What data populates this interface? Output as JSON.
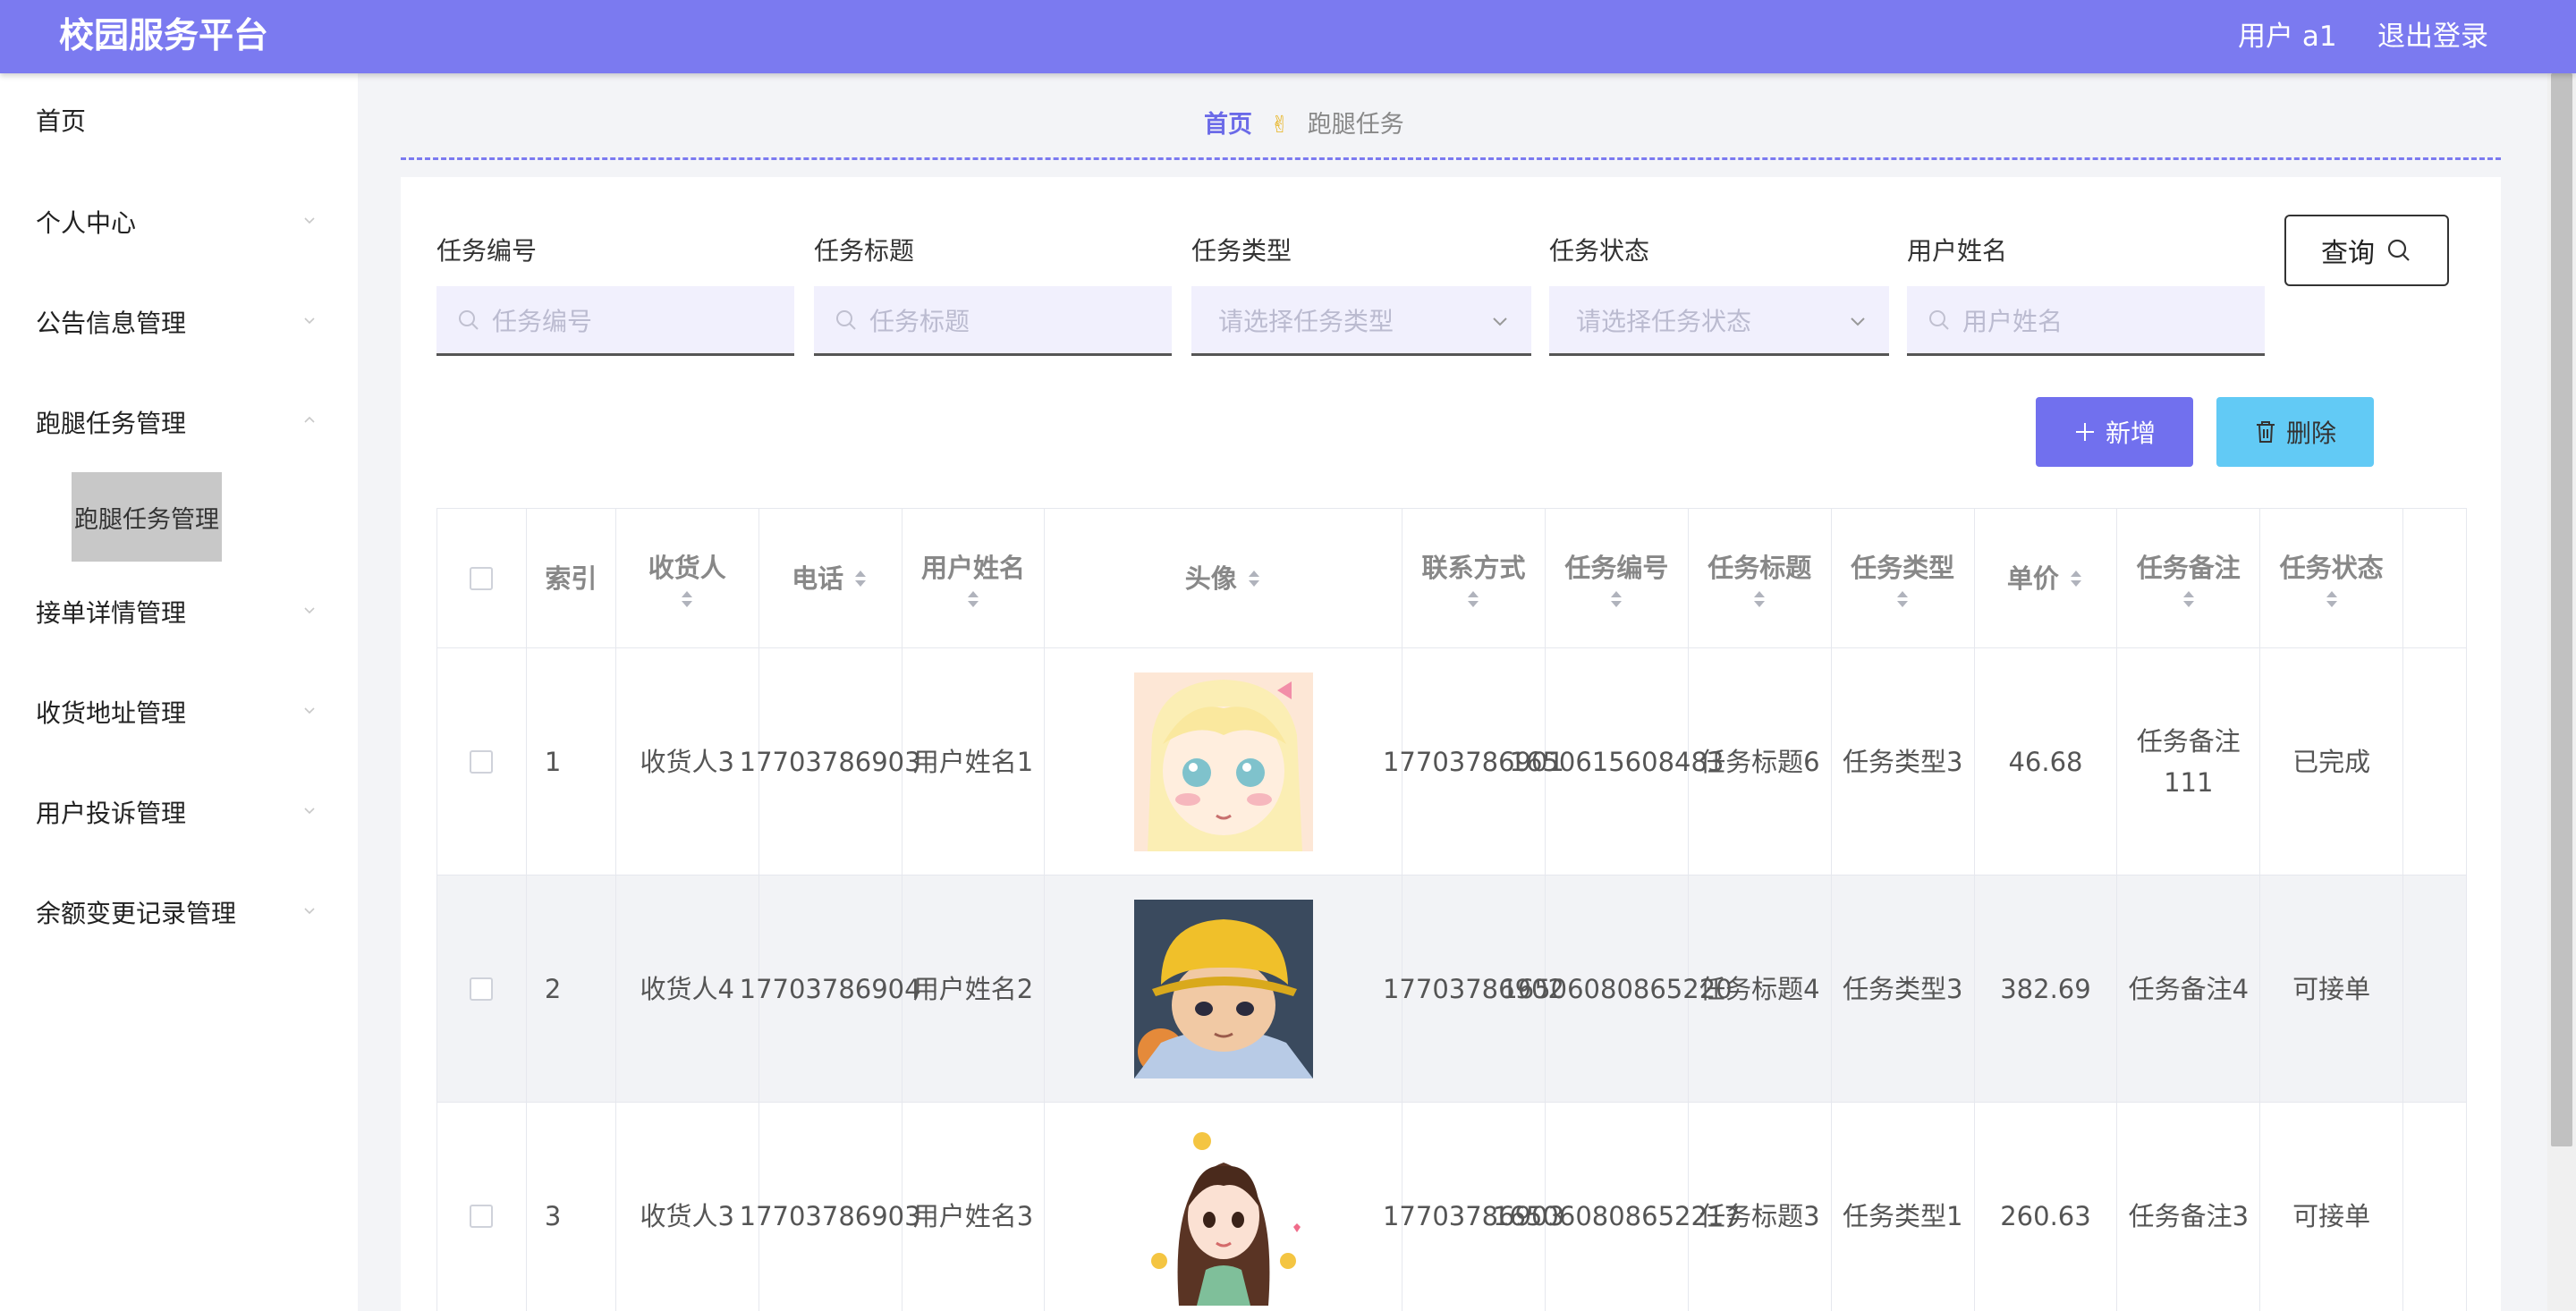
{
  "header": {
    "logo": "校园服务平台",
    "user": "用户 a1",
    "logout": "退出登录"
  },
  "sidebar": {
    "items": [
      {
        "label": "首页"
      },
      {
        "label": "个人中心"
      },
      {
        "label": "公告信息管理"
      },
      {
        "label": "跑腿任务管理"
      },
      {
        "label": "接单详情管理"
      },
      {
        "label": "收货地址管理"
      },
      {
        "label": "用户投诉管理"
      },
      {
        "label": "余额变更记录管理"
      }
    ],
    "submenu_active": "跑腿任务管理"
  },
  "breadcrumb": {
    "home": "首页",
    "separator": "✌",
    "current": "跑腿任务"
  },
  "search": {
    "fields": [
      {
        "label": "任务编号",
        "placeholder": "任务编号"
      },
      {
        "label": "任务标题",
        "placeholder": "任务标题"
      },
      {
        "label": "任务类型",
        "placeholder": "请选择任务类型"
      },
      {
        "label": "任务状态",
        "placeholder": "请选择任务状态"
      },
      {
        "label": "用户姓名",
        "placeholder": "用户姓名"
      }
    ],
    "query_button": "查询"
  },
  "actions": {
    "add": "新增",
    "delete": "删除"
  },
  "table": {
    "headers": {
      "index": "索引",
      "receiver": "收货人",
      "phone": "电话",
      "username": "用户姓名",
      "avatar": "头像",
      "contact": "联系方式",
      "task_no": "任务编号",
      "task_title": "任务标题",
      "task_type": "任务类型",
      "price": "单价",
      "task_remark": "任务备注",
      "task_status": "任务状态"
    },
    "rows": [
      {
        "index": "1",
        "receiver": "收货人3",
        "phone": "17703786903",
        "username": "用户姓名1",
        "contact": "17703786901",
        "task_no": "1650615608483",
        "task_title": "任务标题6",
        "task_type": "任务类型3",
        "price": "46.68",
        "task_remark": "任务备注111",
        "task_status": "已完成"
      },
      {
        "index": "2",
        "receiver": "收货人4",
        "phone": "17703786904",
        "username": "用户姓名2",
        "contact": "17703786902",
        "task_no": "16506080865220",
        "task_title": "任务标题4",
        "task_type": "任务类型3",
        "price": "382.69",
        "task_remark": "任务备注4",
        "task_status": "可接单"
      },
      {
        "index": "3",
        "receiver": "收货人3",
        "phone": "17703786903",
        "username": "用户姓名3",
        "contact": "17703786903",
        "task_no": "165060808652217",
        "task_title": "任务标题3",
        "task_type": "任务类型1",
        "price": "260.63",
        "task_remark": "任务备注3",
        "task_status": "可接单"
      }
    ]
  },
  "colors": {
    "header": "#7b7af0",
    "accent": "#6b6ae8",
    "add_button": "#7170ee",
    "delete_button": "#62caf5"
  }
}
